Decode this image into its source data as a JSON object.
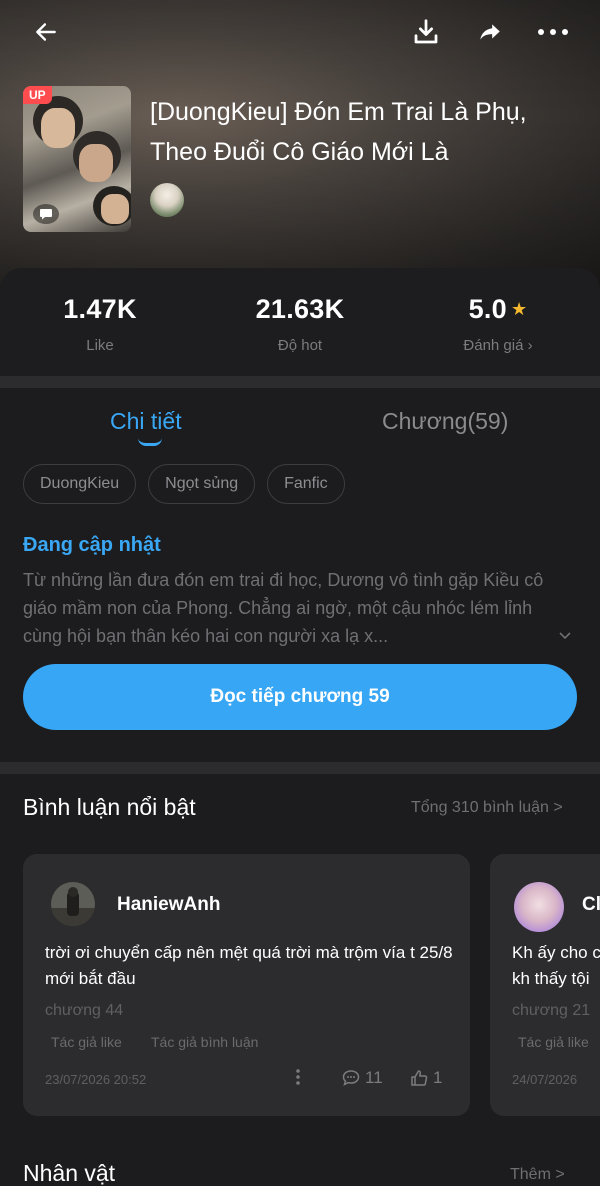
{
  "header": {
    "back_icon": "arrow-left-icon",
    "download_icon": "download-icon",
    "share_icon": "share-icon",
    "more_icon": "more-dots-icon"
  },
  "story": {
    "cover_badge": "UP",
    "title": "[DuongKieu] Đón Em Trai Là Phụ, Theo Đuổi Cô Giáo Mới Là"
  },
  "stats": [
    {
      "value": "1.47K",
      "label": "Like"
    },
    {
      "value": "21.63K",
      "label": "Độ hot"
    },
    {
      "value": "5.0",
      "label": "Đánh giá",
      "label_suffix": "›"
    }
  ],
  "tabs": [
    {
      "label": "Chi tiết",
      "active": true
    },
    {
      "label": "Chương(59)",
      "active": false
    }
  ],
  "tags": [
    "DuongKieu",
    "Ngọt sủng",
    "Fanfic"
  ],
  "status": "Đang cập nhật",
  "description": "Từ những lần đưa đón em trai đi học, Dương vô tình gặp Kiều cô giáo mầm non của Phong. Chẳng ai ngờ, một cậu nhóc lém lỉnh cùng hội bạn thân  kéo hai con người xa lạ x...",
  "read_button": "Đọc tiếp chương 59",
  "comments_section": {
    "title": "Bình luận nổi bật",
    "total": "Tổng 310 bình luận >",
    "items": [
      {
        "name": "HaniewAnh",
        "text": "trời ơi chuyển cấp nên mệt quá trời mà trộm vía t 25/8 mới bắt đầu",
        "chapter": "chương 44",
        "author_like": "Tác giả like",
        "author_comment": "Tác giả bình luận",
        "date": "23/07/2026 20:52",
        "replies": "11",
        "likes": "1"
      },
      {
        "name": "Cl",
        "text": "Kh ấy cho c kh thấy tội",
        "chapter": "chương 21",
        "author_like": "Tác giả like",
        "date": "24/07/2026"
      }
    ]
  },
  "characters_section": {
    "title": "Nhân vật",
    "more": "Thêm >"
  },
  "colors": {
    "accent": "#36a6f5",
    "background": "#1c1c1e",
    "card": "#2c2c2e",
    "star": "#f5b82e",
    "badge": "#ff4d4f"
  }
}
